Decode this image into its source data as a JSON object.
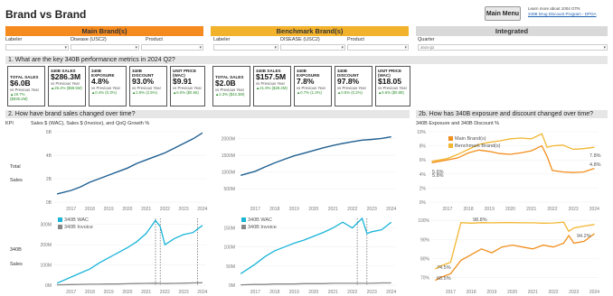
{
  "page": {
    "title": "Brand vs Brand",
    "main_menu_label": "Main Menu",
    "learn_more_text": "Learn more about 1004 GTN",
    "learn_more_link": "340B Drug Discount Program - DPOA"
  },
  "bands": {
    "main": "Main Brand(s)",
    "benchmark": "Benchmark Brand(s)",
    "integrated": "Integrated"
  },
  "filters": {
    "main": {
      "labeler": "Labeler",
      "disease": "Disease (USC2)",
      "product": "Product"
    },
    "benchmark": {
      "labeler": "Labeler",
      "disease": "DISEASE (USC2)",
      "product": "Product"
    },
    "integrated": {
      "quarter": "Quarter",
      "quarter_value": "2024 Q2"
    }
  },
  "sections": {
    "q1": "1. What are the key 340B performance metrics in 2024 Q2?",
    "q2": "2. How have brand sales changed over time?",
    "q2b": "2b. How has 340B exposure and discount changed over time?",
    "kpi": "KPI",
    "sales_title": "Sales $ (WAC), Sales $ (Invoice), and QoQ Growth %",
    "disc_title": "340B Exposure and 340B Discount %",
    "row1": [
      "Total",
      "Sales"
    ],
    "row2": [
      "340B",
      "Sales"
    ]
  },
  "colors": {
    "main_band": "#f58a1f",
    "benchmark_band": "#f2b22b",
    "integrated_band": "#d9d9d9",
    "line_dark": "#1f5f91",
    "line_cyan": "#19b4d8",
    "line_gray": "#888888",
    "main_brand": "#f28e1c",
    "benchmark_brand": "#f2b632",
    "positive": "#2a8c2a"
  },
  "main_cards": [
    {
      "label": "TOTAL SALES",
      "value": "$6.0B",
      "sub": "vs Previous Year",
      "delta": "▲19.7% ($936.2M)"
    },
    {
      "label": "340B SALES",
      "value": "$286.3M",
      "sub": "vs Previous Year",
      "delta": "▲26.2% ($59.5M)"
    },
    {
      "label": "340B EXPOSURE",
      "value": "4.8%",
      "sub": "vs Previous Year",
      "delta": "▲0.4% (0.3%)"
    },
    {
      "label": "340B DISCOUNT",
      "value": "93.0%",
      "sub": "vs Previous Year",
      "delta": "▲2.8% (2.5%)"
    },
    {
      "label": "UNIT PRICE (WAC)",
      "value": "$9.91",
      "sub": "vs Previous Year",
      "delta": "▲6.0% ($0.56)"
    }
  ],
  "bench_cards": [
    {
      "label": "TOTAL SALES",
      "value": "$2.0B",
      "sub": "vs Previous Year",
      "delta": "▲2.3% ($42.3M)"
    },
    {
      "label": "340B SALES",
      "value": "$157.5M",
      "sub": "vs Previous Year",
      "delta": "▲21.9% ($28.2M)"
    },
    {
      "label": "340B EXPOSURE",
      "value": "7.8%",
      "sub": "vs Previous Year",
      "delta": "▲0.7% (1.3%)"
    },
    {
      "label": "340B DISCOUNT",
      "value": "97.8%",
      "sub": "vs Previous Year",
      "delta": "▲0.5% (0.2%)"
    },
    {
      "label": "UNIT PRICE (WAC)",
      "value": "$18.05",
      "sub": "vs Previous Year",
      "delta": "▲6.6% ($0.88)"
    }
  ],
  "chart_data": [
    {
      "id": "main-total",
      "type": "line",
      "x": [
        2016.75,
        2017.5,
        2018,
        2018.5,
        2019,
        2019.5,
        2020,
        2020.5,
        2021,
        2021.5,
        2022,
        2022.5,
        2023,
        2023.5,
        2024,
        2024.5
      ],
      "series": [
        {
          "values": [
            0.7,
            1.0,
            1.3,
            1.7,
            2.0,
            2.3,
            2.6,
            2.9,
            3.3,
            3.6,
            3.9,
            4.2,
            4.6,
            5.0,
            5.4,
            5.9
          ]
        }
      ],
      "yticks": [
        "0B",
        "2B",
        "4B",
        "6B"
      ],
      "yticks_values": [
        0,
        2,
        4,
        6
      ],
      "ylim": [
        0,
        6
      ],
      "xticks": [
        "2017",
        "2018",
        "2019",
        "2020",
        "2021",
        "2022",
        "2023",
        "2024"
      ]
    },
    {
      "id": "bench-total",
      "type": "line",
      "x": [
        2016.75,
        2017.5,
        2018,
        2018.5,
        2019,
        2019.5,
        2020,
        2020.5,
        2021,
        2021.5,
        2022,
        2022.5,
        2023,
        2023.5,
        2024,
        2024.5
      ],
      "series": [
        {
          "values": [
            900,
            1020,
            1150,
            1270,
            1380,
            1480,
            1560,
            1640,
            1720,
            1790,
            1850,
            1900,
            1950,
            1970,
            2000,
            2050
          ]
        }
      ],
      "yticks": [
        "500M",
        "1000M",
        "1500M",
        "2000M"
      ],
      "yticks_values": [
        500,
        1000,
        1500,
        2000
      ],
      "ylim": [
        100,
        2200
      ],
      "xticks": [
        "2017",
        "2018",
        "2019",
        "2020",
        "2021",
        "2022",
        "2023",
        "2024"
      ]
    },
    {
      "id": "main-340b",
      "type": "line",
      "x": [
        2016.75,
        2017.5,
        2018,
        2018.5,
        2019,
        2019.5,
        2020,
        2020.5,
        2021,
        2021.5,
        2022,
        2022.25,
        2022.5,
        2023,
        2023.5,
        2024,
        2024.5
      ],
      "series": [
        {
          "name": "340B WAC",
          "values": [
            10,
            40,
            60,
            80,
            110,
            135,
            160,
            185,
            215,
            255,
            320,
            290,
            200,
            230,
            250,
            260,
            295
          ]
        },
        {
          "name": "340B Invoice",
          "values": [
            2,
            3,
            4,
            5,
            5,
            6,
            6,
            7,
            8,
            9,
            10,
            9,
            8,
            9,
            10,
            11,
            12
          ]
        }
      ],
      "vlines": [
        2022.0,
        2022.25,
        2024.25
      ],
      "yticks": [
        "0M",
        "100M",
        "200M",
        "300M"
      ],
      "yticks_values": [
        0,
        100,
        200,
        300
      ],
      "ylim": [
        0,
        330
      ],
      "xticks": [
        "2017",
        "2018",
        "2019",
        "2020",
        "2021",
        "2022",
        "2023",
        "2024"
      ]
    },
    {
      "id": "bench-340b",
      "type": "line",
      "x": [
        2016.75,
        2017.5,
        2018,
        2018.5,
        2019,
        2019.5,
        2020,
        2020.5,
        2021,
        2021.5,
        2022,
        2022.5,
        2023,
        2023.25,
        2023.5,
        2024,
        2024.5
      ],
      "series": [
        {
          "name": "340B WAC",
          "values": [
            30,
            55,
            75,
            90,
            100,
            110,
            118,
            128,
            138,
            150,
            165,
            150,
            175,
            135,
            140,
            145,
            165
          ]
        },
        {
          "name": "340B Invoice",
          "values": [
            1,
            2,
            2,
            3,
            3,
            3,
            4,
            4,
            4,
            5,
            5,
            5,
            5,
            5,
            5,
            6,
            6
          ]
        }
      ],
      "vlines": [
        2022.75,
        2023.25
      ],
      "yticks": [
        "0M",
        "50M",
        "100M",
        "150M"
      ],
      "yticks_values": [
        0,
        50,
        100,
        150
      ],
      "ylim": [
        0,
        175
      ],
      "xticks": [
        "2017",
        "2018",
        "2019",
        "2020",
        "2021",
        "2022",
        "2023",
        "2024"
      ]
    },
    {
      "id": "exposure",
      "type": "line",
      "x": [
        2016.75,
        2017.5,
        2018,
        2018.5,
        2019,
        2019.5,
        2020,
        2020.5,
        2021,
        2021.5,
        2022,
        2022.25,
        2022.5,
        2023,
        2023.5,
        2024,
        2024.5
      ],
      "series": [
        {
          "name": "Main Brand(s)",
          "values": [
            5.6,
            6.0,
            6.3,
            7.0,
            7.4,
            7.2,
            6.9,
            6.8,
            7.0,
            7.3,
            8.0,
            6.5,
            4.5,
            4.3,
            4.2,
            4.3,
            4.8
          ]
        },
        {
          "name": "Benchmark Brand(s)",
          "values": [
            5.8,
            6.2,
            6.8,
            7.5,
            8.2,
            8.5,
            8.7,
            9.0,
            9.1,
            9.0,
            9.7,
            7.8,
            8.0,
            8.1,
            7.5,
            7.6,
            7.8
          ]
        }
      ],
      "labels": [
        "5.6%",
        "5.8%",
        "7.8%",
        "4.8%"
      ],
      "yticks": [
        "0%",
        "2%",
        "4%",
        "6%",
        "8%",
        "10%"
      ],
      "yticks_values": [
        0,
        2,
        4,
        6,
        8,
        10
      ],
      "ylim": [
        0,
        10
      ],
      "xticks": [
        "2017",
        "2018",
        "2019",
        "2020",
        "2021",
        "2022",
        "2023",
        "2024"
      ]
    },
    {
      "id": "discount",
      "type": "line",
      "x": [
        2016.75,
        2017.0,
        2017.5,
        2018,
        2018.5,
        2019,
        2019.5,
        2020,
        2020.5,
        2021,
        2021.5,
        2022,
        2022.5,
        2023,
        2023.25,
        2023.5,
        2024,
        2024.5
      ],
      "series": [
        {
          "name": "Main Brand(s)",
          "values": [
            68.5,
            70,
            72,
            79,
            82,
            85,
            83,
            86,
            87,
            86,
            85,
            87,
            86,
            88,
            92,
            88,
            89,
            93.0
          ]
        },
        {
          "name": "Benchmark Brand(s)",
          "values": [
            74.5,
            76,
            78,
            98.8,
            98.5,
            98.8,
            98.7,
            98.8,
            98.8,
            98.7,
            98.7,
            98.5,
            98.6,
            99,
            94.2,
            96,
            97,
            97.8
          ]
        }
      ],
      "labels": [
        "98.8%",
        "94.2%",
        "74.5%",
        "68.5%"
      ],
      "yticks": [
        "70%",
        "80%",
        "90%",
        "100%"
      ],
      "yticks_values": [
        70,
        80,
        90,
        100
      ],
      "ylim": [
        66,
        101
      ],
      "xticks": [
        "2017",
        "2018",
        "2019",
        "2020",
        "2021",
        "2022",
        "2023",
        "2024"
      ]
    }
  ]
}
